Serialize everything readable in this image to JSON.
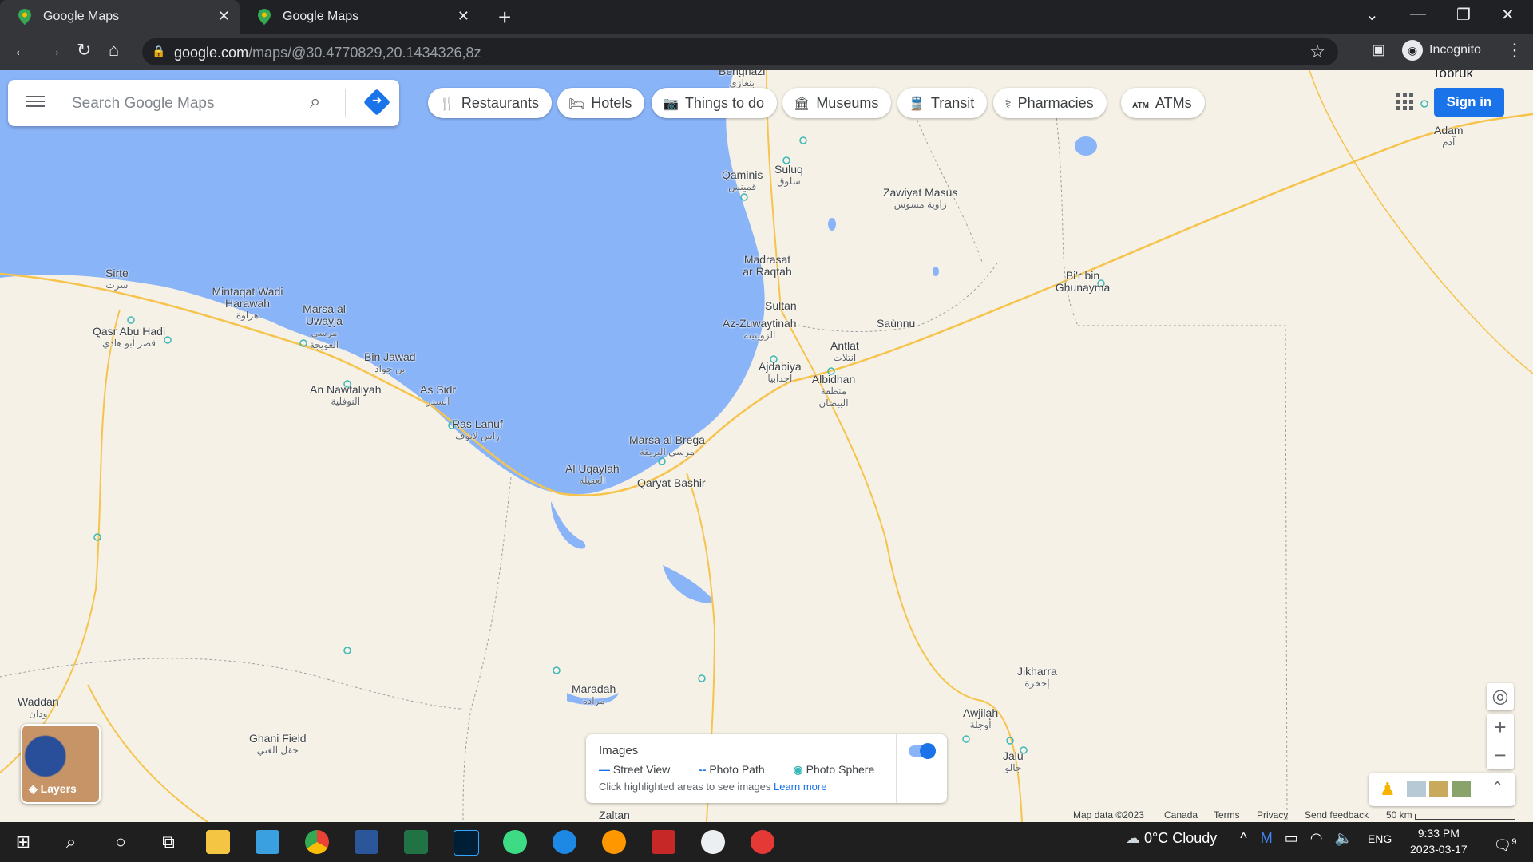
{
  "browser": {
    "tabs": [
      {
        "title": "Google Maps",
        "active": true
      },
      {
        "title": "Google Maps",
        "active": false
      }
    ],
    "url_main": "google.com",
    "url_path": "/maps/@30.4770829,20.1434326,8z",
    "profile": "Incognito"
  },
  "search": {
    "placeholder": "Search Google Maps"
  },
  "chips": [
    "Restaurants",
    "Hotels",
    "Things to do",
    "Museums",
    "Transit",
    "Pharmacies",
    "ATMs"
  ],
  "signin": "Sign in",
  "places": [
    {
      "name": "Benghazi",
      "ar": "بنغازي"
    },
    {
      "name": "Tobruk",
      "ar": ""
    },
    {
      "name": "Adam",
      "ar": "آدم"
    },
    {
      "name": "Qaminis",
      "ar": "قمينس"
    },
    {
      "name": "Suluq",
      "ar": "سلوق"
    },
    {
      "name": "Zawiyat Masus",
      "ar": "زاوية مسوس"
    },
    {
      "name": "Madrasat ar Raqtah",
      "ar": ""
    },
    {
      "name": "Bi'r bin Ghunayma",
      "ar": ""
    },
    {
      "name": "Sultan",
      "ar": ""
    },
    {
      "name": "Az-Zuwaytinah",
      "ar": "الزويتينة"
    },
    {
      "name": "Saùnnu",
      "ar": ""
    },
    {
      "name": "Antlat",
      "ar": "انتلات"
    },
    {
      "name": "Ajdabiya",
      "ar": "اجدابيا"
    },
    {
      "name": "Albidhan",
      "ar": "منطقة البيضان"
    },
    {
      "name": "Sirte",
      "ar": "سرت"
    },
    {
      "name": "Mintaqat Wadi Harawah",
      "ar": "هراوة"
    },
    {
      "name": "Marsa al Uwayja",
      "ar": "مرسى العويجة"
    },
    {
      "name": "Qasr Abu Hadi",
      "ar": "قصر أبو هادي"
    },
    {
      "name": "Bin Jawad",
      "ar": "بن جواد"
    },
    {
      "name": "An Nawfaliyah",
      "ar": "النوفلية"
    },
    {
      "name": "As Sidr",
      "ar": "السدر"
    },
    {
      "name": "Ras Lanuf",
      "ar": "راس لانوف"
    },
    {
      "name": "Marsa al Brega",
      "ar": "مرسى البريقة"
    },
    {
      "name": "Al Uqaylah",
      "ar": "العقيلة"
    },
    {
      "name": "Qaryat Bashir",
      "ar": ""
    },
    {
      "name": "Maradah",
      "ar": "مرادة"
    },
    {
      "name": "Jikharra",
      "ar": "إجخرة"
    },
    {
      "name": "Awjilah",
      "ar": "أوجلة"
    },
    {
      "name": "Jalu",
      "ar": "جالو"
    },
    {
      "name": "Waddan",
      "ar": "ودان"
    },
    {
      "name": "Ghani Field",
      "ar": "حقل الغني"
    },
    {
      "name": "Zaltan",
      "ar": ""
    }
  ],
  "layers_label": "Layers",
  "images_panel": {
    "title": "Images",
    "legend": [
      "Street View",
      "Photo Path",
      "Photo Sphere"
    ],
    "hint": "Click highlighted areas to see images",
    "learn_more": "Learn more"
  },
  "footer": {
    "map_data": "Map data ©2023",
    "country": "Canada",
    "terms": "Terms",
    "privacy": "Privacy",
    "feedback": "Send feedback",
    "scale": "50 km"
  },
  "taskbar": {
    "weather": "0°C  Cloudy",
    "lang": "ENG",
    "time": "9:33 PM",
    "date": "2023-03-17",
    "notifications": "9"
  },
  "colors": {
    "water": "#8ab4f8",
    "land": "#f5f1e6",
    "road": "#f6c44c",
    "accent": "#1a73e8"
  }
}
